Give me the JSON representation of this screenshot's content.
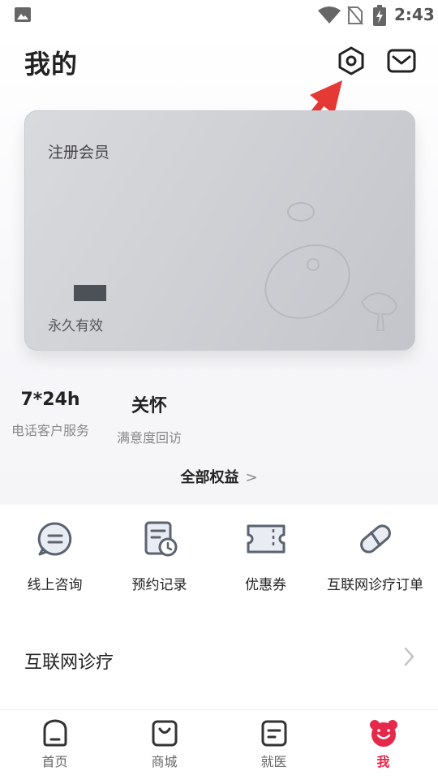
{
  "status_bar": {
    "time": "2:43",
    "icons": [
      "image-icon",
      "wifi-icon",
      "no-sim-icon",
      "battery-charging-icon"
    ]
  },
  "header": {
    "title": "我的",
    "settings_icon": "settings-icon",
    "message_icon": "mail-icon"
  },
  "member_card": {
    "level": "注册会员",
    "validity": "永久有效"
  },
  "benefits": [
    {
      "value": "7*24h",
      "label": "电话客户服务"
    },
    {
      "value": "关怀",
      "label": "满意度回访"
    }
  ],
  "all_benefits": {
    "label": "全部权益",
    "chevron": ">"
  },
  "services": [
    {
      "label": "线上咨询",
      "icon": "chat-icon"
    },
    {
      "label": "预约记录",
      "icon": "appointment-record-icon"
    },
    {
      "label": "优惠券",
      "icon": "coupon-icon"
    },
    {
      "label": "互联网诊疗订单",
      "icon": "pill-icon"
    }
  ],
  "menu": {
    "internet_diagnosis": "互联网诊疗"
  },
  "bottom_nav": [
    {
      "label": "首页",
      "icon": "home-icon"
    },
    {
      "label": "商城",
      "icon": "shop-bag-icon"
    },
    {
      "label": "就医",
      "icon": "medical-icon"
    },
    {
      "label": "我",
      "icon": "bear-icon",
      "active": true
    }
  ],
  "colors": {
    "accent": "#e6294b",
    "arrow": "#e53935",
    "card": "#cfd1d5"
  }
}
